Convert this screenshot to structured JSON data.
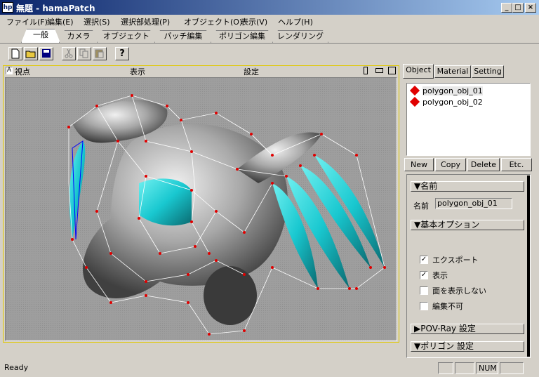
{
  "window": {
    "icon_text": "hp",
    "title": "無題 - hamaPatch",
    "min": "_",
    "max": "□",
    "close": "×"
  },
  "menu": [
    "ファイル(F)",
    "編集(E)",
    "選択(S)",
    "選択部処理(P)",
    "オブジェクト(O)",
    "表示(V)",
    "ヘルプ(H)"
  ],
  "tabs": [
    "一般",
    "カメラ",
    "オブジェクト",
    "パッチ編集",
    "ポリゴン編集",
    "レンダリング"
  ],
  "toolbar": {
    "new": "new-file-icon",
    "open": "open-folder-icon",
    "save": "save-disk-icon",
    "cut": "cut-icon",
    "copy": "copy-icon",
    "paste": "paste-icon",
    "help": "?"
  },
  "viewport": {
    "corner": "A",
    "viewpoint": "視点",
    "display": "表示",
    "settings": "設定"
  },
  "right_tabs": [
    "Object",
    "Material",
    "Setting"
  ],
  "objects": [
    "polygon_obj_01",
    "polygon_obj_02"
  ],
  "object_buttons": [
    "New",
    "Copy",
    "Delete",
    "Etc."
  ],
  "props": {
    "name_section": "▼名前",
    "name_label": "名前",
    "name_value": "polygon_obj_01",
    "basic_section": "▼基本オプション",
    "options": [
      {
        "label": "エクスポート",
        "checked": "✓"
      },
      {
        "label": "表示",
        "checked": "✓"
      },
      {
        "label": "面を表示しない",
        "checked": ""
      },
      {
        "label": "編集不可",
        "checked": ""
      }
    ],
    "povray_section": "▶POV-Ray 設定",
    "polygon_section": "▼ポリゴン 設定"
  },
  "status": {
    "text": "Ready",
    "num": "NUM"
  },
  "colors": {
    "title_start": "#0a246a",
    "accent_cyan": "#19c8d0",
    "viewport_border": "#e0c800"
  }
}
